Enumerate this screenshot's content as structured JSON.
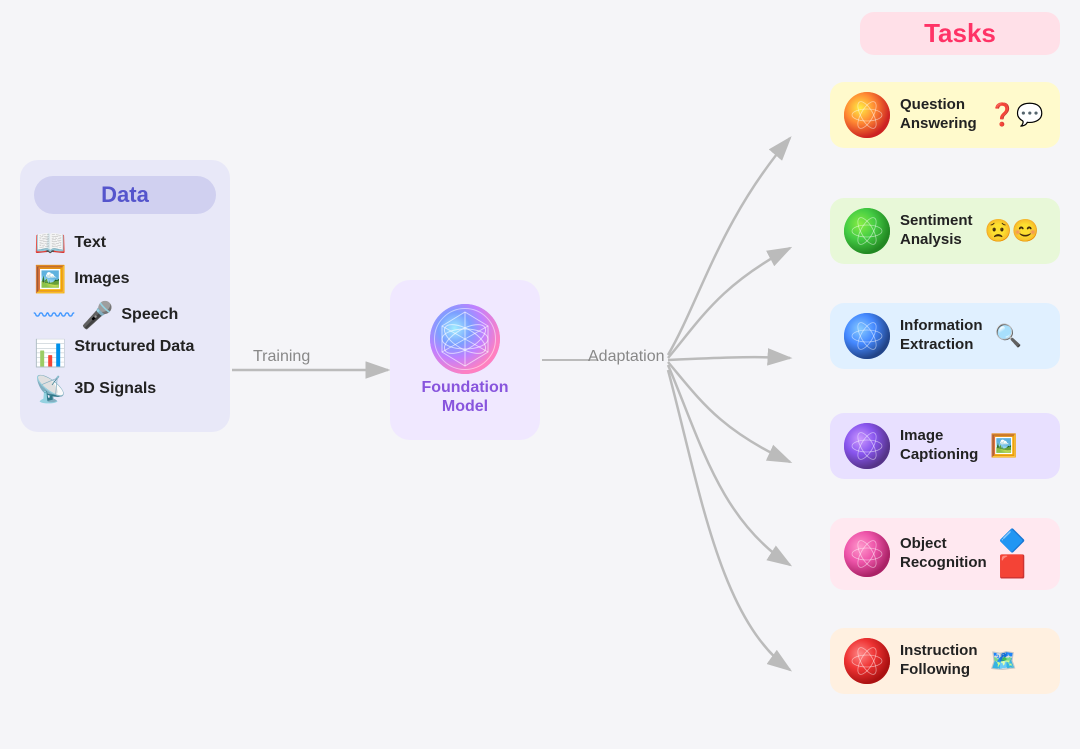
{
  "data_panel": {
    "label": "Data",
    "items": [
      {
        "id": "text",
        "label": "Text",
        "emoji": "📖"
      },
      {
        "id": "images",
        "label": "Images",
        "emoji": "🖼️"
      },
      {
        "id": "speech",
        "label": "Speech",
        "emoji": "🎤"
      },
      {
        "id": "structured",
        "label": "Structured Data",
        "emoji": "📊"
      },
      {
        "id": "signals",
        "label": "3D Signals",
        "emoji": "📡"
      }
    ]
  },
  "foundation": {
    "label_line1": "Foundation",
    "label_line2": "Model"
  },
  "labels": {
    "training": "Training",
    "adaptation": "Adaptation",
    "tasks_header": "Tasks"
  },
  "tasks": [
    {
      "id": "qa",
      "label": "Question\nAnswering",
      "icons": "❓💬",
      "orb_class": "orb-qa",
      "card_class": "card-qa"
    },
    {
      "id": "sa",
      "label": "Sentiment\nAnalysis",
      "icons": "😟😊",
      "orb_class": "orb-sa",
      "card_class": "card-sa"
    },
    {
      "id": "ie",
      "label": "Information\nExtraction",
      "icons": "🔍",
      "orb_class": "orb-ie",
      "card_class": "card-ie"
    },
    {
      "id": "ic",
      "label": "Image\nCaptioning",
      "icons": "🖼️",
      "orb_class": "orb-ic",
      "card_class": "card-ic"
    },
    {
      "id": "or",
      "label": "Object\nRecognition",
      "icons": "🔷🟥",
      "orb_class": "orb-or",
      "card_class": "card-or"
    },
    {
      "id": "if",
      "label": "Instruction\nFollowing",
      "icons": "🗺️",
      "orb_class": "orb-if",
      "card_class": "card-if"
    }
  ]
}
